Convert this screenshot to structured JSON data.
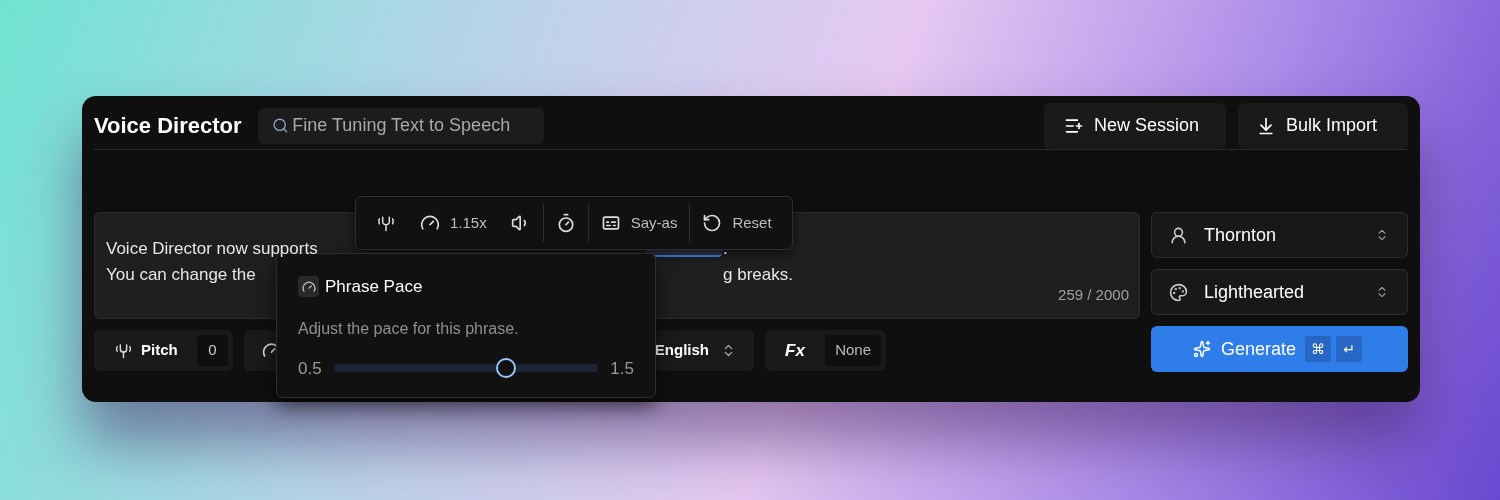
{
  "app": {
    "title": "Voice Director"
  },
  "search": {
    "placeholder": "Fine Tuning Text to Speech"
  },
  "header_buttons": [
    {
      "kind": "new",
      "label": "New Session"
    },
    {
      "kind": "import",
      "label": "Bulk Import"
    }
  ],
  "editor": {
    "lines": [
      {
        "left": "Voice Director now supports",
        "right": "."
      },
      {
        "left": "You can change the",
        "right": "g breaks."
      }
    ],
    "counter": "259 / 2000"
  },
  "toolbar": [
    {
      "kind": "pitch"
    },
    {
      "kind": "pace",
      "label": "1.15x"
    },
    {
      "kind": "volume"
    },
    {
      "kind": "timer"
    },
    {
      "kind": "say_as",
      "label": "Say-as"
    },
    {
      "kind": "reset",
      "label": "Reset"
    }
  ],
  "popover": {
    "title": "Phrase Pace",
    "description": "Adjust the pace for this phrase.",
    "min": "0.5",
    "max": "1.5",
    "level": 0.65
  },
  "controls": [
    {
      "kind": "pitch",
      "label": "Pitch",
      "value": "0"
    },
    {
      "kind": "pace"
    },
    {
      "kind": "language",
      "value": "English"
    },
    {
      "kind": "effects",
      "label": "Fx",
      "value": "None"
    }
  ],
  "selects": [
    {
      "kind": "voice",
      "value": "Thornton"
    },
    {
      "kind": "style",
      "value": "Lighthearted"
    }
  ],
  "generate": {
    "label": "Generate",
    "keys": [
      "⌘",
      "↵"
    ]
  }
}
